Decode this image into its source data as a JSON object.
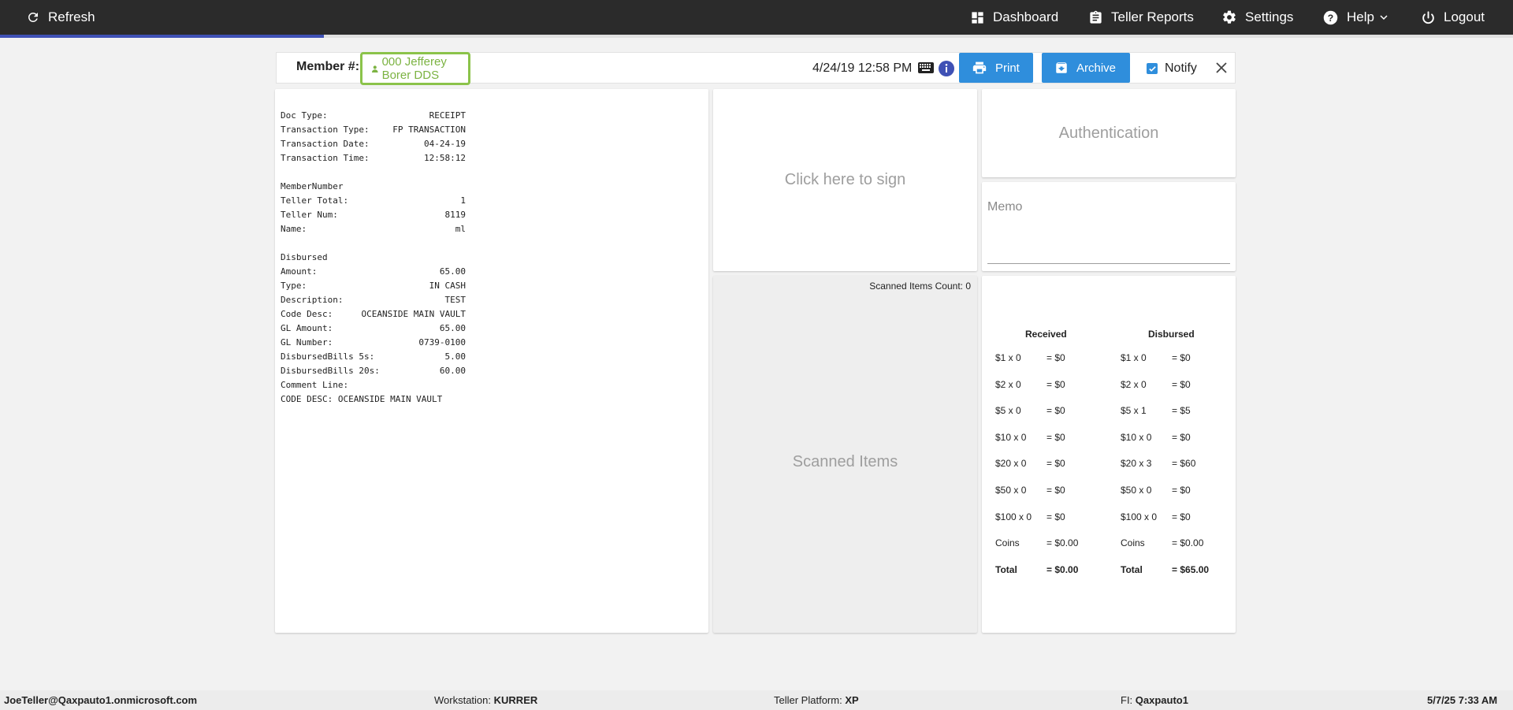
{
  "topbar": {
    "refresh_label": "Refresh",
    "dashboard_label": "Dashboard",
    "teller_reports_label": "Teller Reports",
    "settings_label": "Settings",
    "help_label": "Help",
    "logout_label": "Logout",
    "progress_fraction": 0.214
  },
  "header": {
    "member_label": "Member #:",
    "member_value": "000 Jefferey Borer DDS",
    "datetime": "4/24/19 12:58 PM",
    "print_label": "Print",
    "archive_label": "Archive",
    "notify_label": "Notify",
    "notify_checked": true
  },
  "receipt": {
    "rows": [
      {
        "k": "Doc Type:",
        "v": "RECEIPT"
      },
      {
        "k": "Transaction Type:",
        "v": "FP TRANSACTION"
      },
      {
        "k": "Transaction Date:",
        "v": "04-24-19"
      },
      {
        "k": "Transaction Time:",
        "v": "12:58:12"
      },
      {
        "k": "",
        "v": ""
      },
      {
        "k": "MemberNumber",
        "v": ""
      },
      {
        "k": "Teller Total:",
        "v": "1"
      },
      {
        "k": "Teller Num:",
        "v": "8119"
      },
      {
        "k": "Name:",
        "v": "ml"
      },
      {
        "k": "",
        "v": ""
      },
      {
        "k": "Disbursed",
        "v": ""
      },
      {
        "k": "Amount:",
        "v": "65.00"
      },
      {
        "k": "Type:",
        "v": "IN CASH"
      },
      {
        "k": "Description:",
        "v": "TEST"
      },
      {
        "k": "Code Desc:",
        "v": "OCEANSIDE MAIN VAULT"
      },
      {
        "k": "GL Amount:",
        "v": "65.00"
      },
      {
        "k": "GL Number:",
        "v": "0739-0100"
      },
      {
        "k": "DisbursedBills 5s:",
        "v": "5.00"
      },
      {
        "k": "DisbursedBills 20s:",
        "v": "60.00"
      },
      {
        "k": "Comment Line:",
        "v": ""
      },
      {
        "k": "CODE DESC: OCEANSIDE MAIN VAULT",
        "v": ""
      }
    ]
  },
  "sign": {
    "label": "Click here to sign"
  },
  "scanned": {
    "count_label": "Scanned Items Count: 0",
    "label": "Scanned Items"
  },
  "auth": {
    "label": "Authentication"
  },
  "memo": {
    "label": "Memo"
  },
  "cash": {
    "received_header": "Received",
    "disbursed_header": "Disbursed",
    "received": [
      {
        "d": "$1 x 0",
        "a": "= $0"
      },
      {
        "d": "$2 x 0",
        "a": "= $0"
      },
      {
        "d": "$5 x 0",
        "a": "= $0"
      },
      {
        "d": "$10 x 0",
        "a": "= $0"
      },
      {
        "d": "$20 x 0",
        "a": "= $0"
      },
      {
        "d": "$50 x 0",
        "a": "= $0"
      },
      {
        "d": "$100 x 0",
        "a": "= $0"
      },
      {
        "d": "Coins",
        "a": "= $0.00"
      },
      {
        "d": "Total",
        "a": "= $0.00"
      }
    ],
    "disbursed": [
      {
        "d": "$1 x 0",
        "a": "= $0"
      },
      {
        "d": "$2 x 0",
        "a": "= $0"
      },
      {
        "d": "$5 x 1",
        "a": "= $5"
      },
      {
        "d": "$10 x 0",
        "a": "= $0"
      },
      {
        "d": "$20 x 3",
        "a": "= $60"
      },
      {
        "d": "$50 x 0",
        "a": "= $0"
      },
      {
        "d": "$100 x 0",
        "a": "= $0"
      },
      {
        "d": "Coins",
        "a": "= $0.00"
      },
      {
        "d": "Total",
        "a": "= $65.00"
      }
    ]
  },
  "footer": {
    "user": "JoeTeller@Qaxpauto1.onmicrosoft.com",
    "workstation_label": "Workstation:",
    "workstation_value": "KURRER",
    "platform_label": "Teller Platform:",
    "platform_value": "XP",
    "fi_label": "FI:",
    "fi_value": "Qaxpauto1",
    "datetime": "5/7/25 7:33 AM"
  },
  "colors": {
    "topbar": "#2b2b2b",
    "accent": "#2f8edc",
    "member_border": "#8bc34a",
    "progress": "#3f51b5"
  }
}
